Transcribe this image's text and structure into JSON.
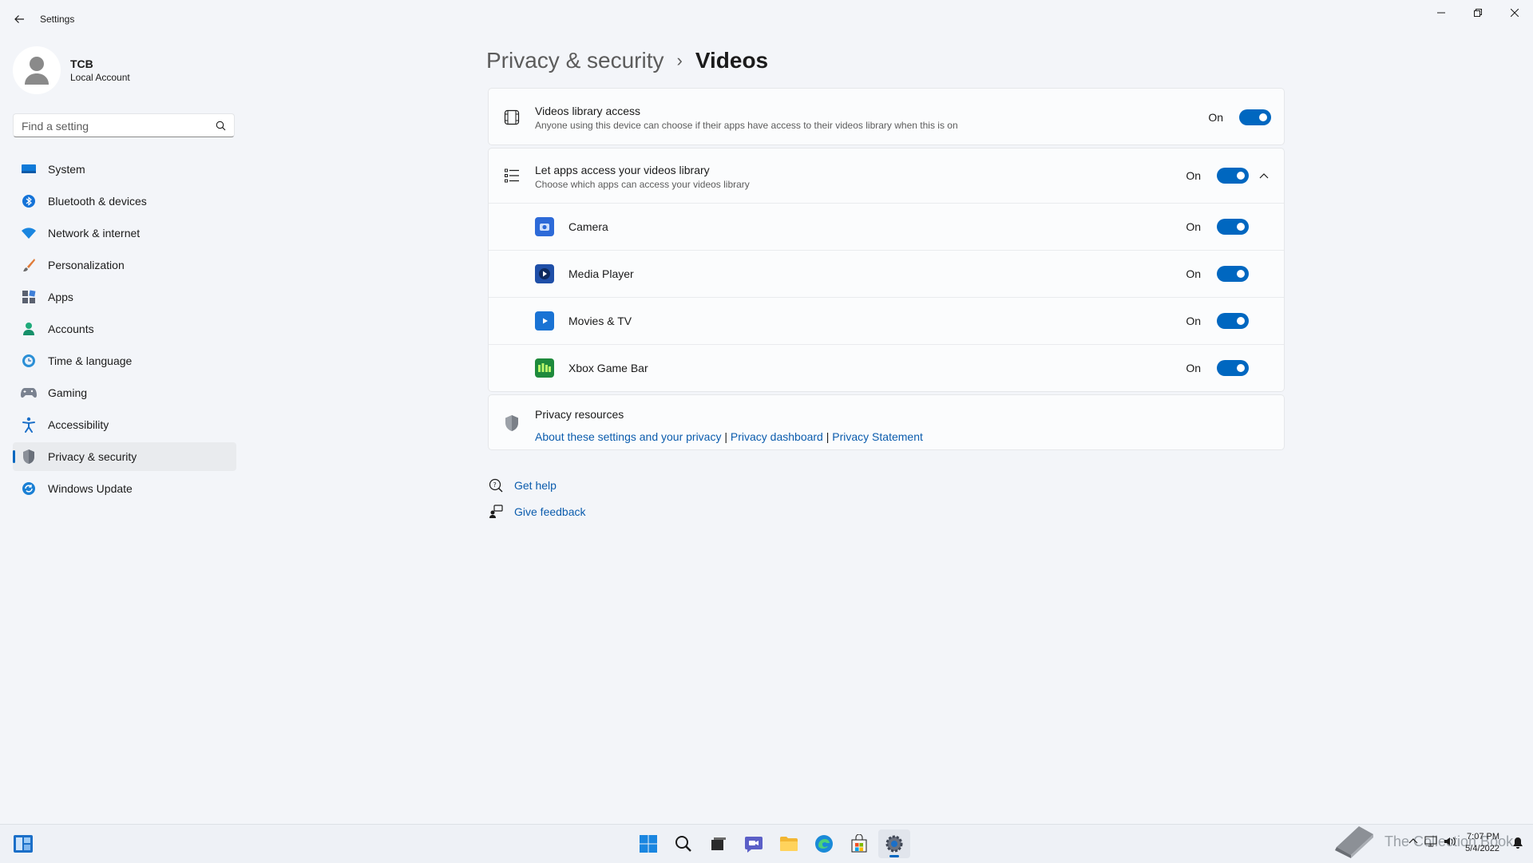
{
  "window": {
    "title": "Settings"
  },
  "profile": {
    "name": "TCB",
    "account_type": "Local Account"
  },
  "search": {
    "placeholder": "Find a setting"
  },
  "sidebar": {
    "items": [
      {
        "label": "System",
        "icon": "monitor-icon"
      },
      {
        "label": "Bluetooth & devices",
        "icon": "bluetooth-icon"
      },
      {
        "label": "Network & internet",
        "icon": "wifi-icon"
      },
      {
        "label": "Personalization",
        "icon": "brush-icon"
      },
      {
        "label": "Apps",
        "icon": "apps-icon"
      },
      {
        "label": "Accounts",
        "icon": "person-icon"
      },
      {
        "label": "Time & language",
        "icon": "clock-globe-icon"
      },
      {
        "label": "Gaming",
        "icon": "gamepad-icon"
      },
      {
        "label": "Accessibility",
        "icon": "accessibility-icon"
      },
      {
        "label": "Privacy & security",
        "icon": "shield-icon",
        "selected": true
      },
      {
        "label": "Windows Update",
        "icon": "update-icon"
      }
    ]
  },
  "breadcrumb": {
    "parent": "Privacy & security",
    "separator": "›",
    "current": "Videos"
  },
  "library_access": {
    "title": "Videos library access",
    "description": "Anyone using this device can choose if their apps have access to their videos library when this is on",
    "state_label": "On",
    "on": true
  },
  "app_access": {
    "title": "Let apps access your videos library",
    "description": "Choose which apps can access your videos library",
    "state_label": "On",
    "on": true,
    "expanded": true,
    "apps": [
      {
        "name": "Camera",
        "state_label": "On",
        "on": true,
        "icon": "camera-app-icon",
        "color": "#2d6ad8"
      },
      {
        "name": "Media Player",
        "state_label": "On",
        "on": true,
        "icon": "media-player-app-icon",
        "color": "#1f4fa8"
      },
      {
        "name": "Movies & TV",
        "state_label": "On",
        "on": true,
        "icon": "movies-tv-app-icon",
        "color": "#1a73d4"
      },
      {
        "name": "Xbox Game Bar",
        "state_label": "On",
        "on": true,
        "icon": "xbox-game-bar-app-icon",
        "color": "#1e8a3c"
      }
    ]
  },
  "privacy_resources": {
    "title": "Privacy resources",
    "links": [
      "About these settings and your privacy",
      "Privacy dashboard",
      "Privacy Statement"
    ],
    "divider": "|"
  },
  "help": {
    "get_help": "Get help",
    "give_feedback": "Give feedback"
  },
  "taskbar": {
    "pinned": [
      "start-icon",
      "search-icon",
      "task-view-icon",
      "chat-icon",
      "file-explorer-icon",
      "edge-icon",
      "store-icon",
      "settings-icon"
    ],
    "watermark": "The Collection Book",
    "time": "7:07 PM",
    "date": "5/4/2022"
  },
  "colors": {
    "accent": "#0067c0",
    "link": "#0b5cad",
    "background": "#f3f5f9"
  }
}
